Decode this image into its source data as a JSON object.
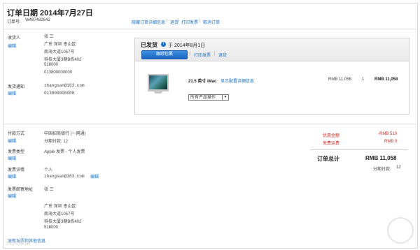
{
  "header": {
    "title": "订单日期 2014年7月27日",
    "order_label": "订单号:",
    "order_number": "W487482642",
    "links": [
      "隐藏订单详细信息",
      "退货",
      "打印发票",
      "取消订单"
    ]
  },
  "address": {
    "label": "收货人",
    "edit": "编辑",
    "name": "张 三",
    "lines": [
      "广东 深圳 南山区",
      "南海大道1057号",
      "科技大厦3期B栋402",
      "518000",
      "013800000000"
    ]
  },
  "contact": {
    "label": "发货通知",
    "edit": "编辑",
    "email": "zhangsan@163.com",
    "phone": "013800000000"
  },
  "shipment": {
    "status": "已发货",
    "date": "于 2014年8月1日",
    "track_button": "跟踪包裹",
    "links": [
      "打印发票",
      "退货"
    ],
    "item_name": "21.5 英寸 iMac",
    "item_details_link": "显示配置详细信息",
    "unit_price": "RMB 11,058",
    "quantity": "1",
    "line_total": "RMB 11,058",
    "actions_select": "所有产品操作"
  },
  "payment": {
    "label": "付款方式",
    "edit": "编辑",
    "method": "中国招商银行 (一网通)",
    "installments": "分期付款: 12"
  },
  "invoice_type": {
    "label": "发票类型",
    "edit": "编辑",
    "value": "Apple 发票 - 个人发票"
  },
  "invoice_info": {
    "label": "发票详情",
    "edit": "编辑",
    "type": "个人",
    "email": "zhangsan@163.com",
    "email_edit": "编辑"
  },
  "invoice_address": {
    "label": "发票邮寄地址",
    "edit": "编辑",
    "name": "张 三",
    "lines": [
      "广东 深圳 南山区",
      "南海大道1057号",
      "科技大厦3期B栋402",
      "518000"
    ]
  },
  "footer_link": "更新发票和其他信息",
  "summary": {
    "discount_label": "优惠金额",
    "discount_value": "-RMB 510",
    "shipping_label": "免费运费",
    "shipping_value": "RMB 0",
    "total_label": "订单总计",
    "total_value": "RMB 11,058",
    "installments_label": "分期付款:",
    "installments_value": "12"
  },
  "watermark": "天天观察"
}
